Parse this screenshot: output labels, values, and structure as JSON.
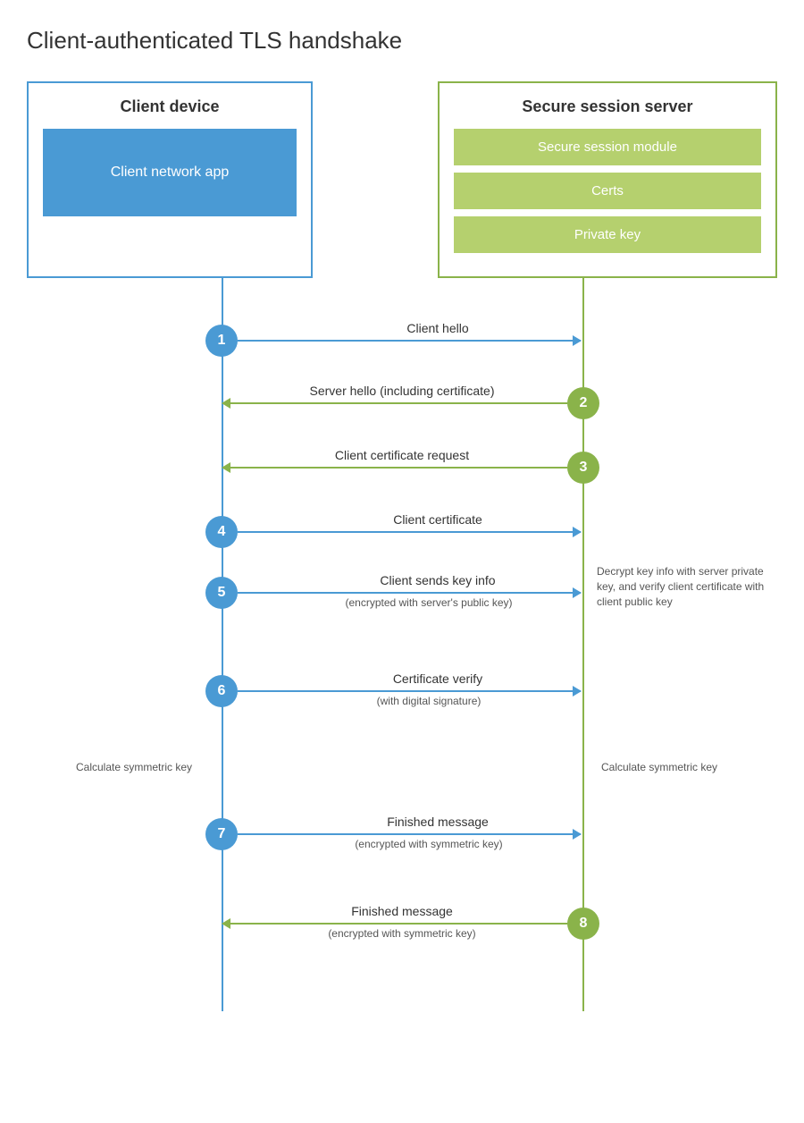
{
  "title": "Client-authenticated TLS handshake",
  "client_box": {
    "title": "Client device",
    "app_label": "Client network app"
  },
  "server_box": {
    "title": "Secure session server",
    "modules": [
      "Secure session module",
      "Certs",
      "Private key"
    ]
  },
  "steps": [
    {
      "num": "1",
      "label": "Client hello",
      "direction": "right",
      "circle_side": "left",
      "sublabel": ""
    },
    {
      "num": "2",
      "label": "Server hello (including certificate)",
      "direction": "left",
      "circle_side": "right",
      "sublabel": ""
    },
    {
      "num": "3",
      "label": "Client certificate request",
      "direction": "left",
      "circle_side": "right",
      "sublabel": ""
    },
    {
      "num": "4",
      "label": "Client certificate",
      "direction": "right",
      "circle_side": "left",
      "sublabel": ""
    },
    {
      "num": "5",
      "label": "Client sends key info",
      "direction": "right",
      "circle_side": "left",
      "sublabel": "(encrypted with server's public key)"
    },
    {
      "num": "6",
      "label": "Certificate verify",
      "direction": "right",
      "circle_side": "left",
      "sublabel": "(with digital signature)"
    },
    {
      "num": "7",
      "label": "Finished message",
      "direction": "right",
      "circle_side": "left",
      "sublabel": "(encrypted with symmetric key)"
    },
    {
      "num": "8",
      "label": "Finished message",
      "direction": "left",
      "circle_side": "right",
      "sublabel": "(encrypted with symmetric key)"
    }
  ],
  "side_notes": {
    "left_calc": "Calculate\nsymmetric key",
    "right_calc": "Calculate\nsymmetric key",
    "right_decrypt": "Decrypt key info with\nserver private key, and\nverify client certificate\nwith client public key"
  }
}
